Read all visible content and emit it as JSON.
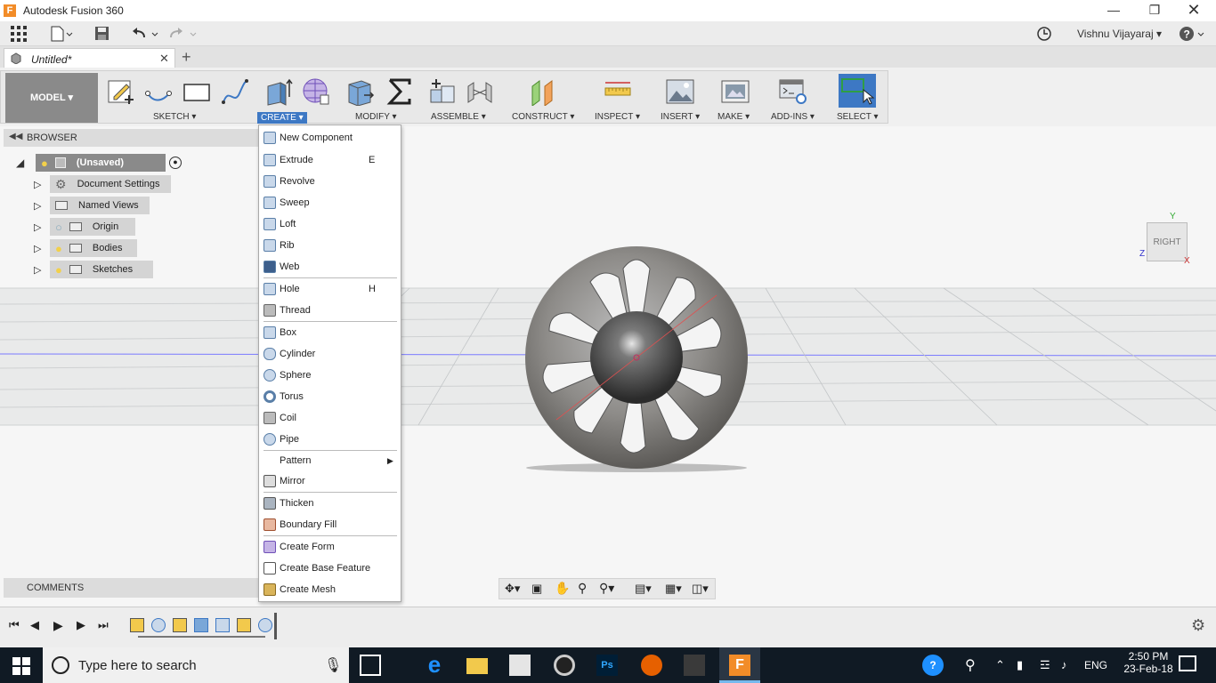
{
  "window": {
    "title": "Autodesk Fusion 360",
    "logo": "F"
  },
  "quick_access": {
    "user": "Vishnu Vijayaraj"
  },
  "tab": {
    "label": "Untitled*"
  },
  "ribbon": {
    "workspace": "MODEL",
    "groups": [
      "SKETCH",
      "CREATE",
      "MODIFY",
      "ASSEMBLE",
      "CONSTRUCT",
      "INSPECT",
      "INSERT",
      "MAKE",
      "ADD-INS",
      "SELECT"
    ]
  },
  "browser": {
    "title": "BROWSER",
    "root": "(Unsaved)",
    "items": [
      "Document Settings",
      "Named Views",
      "Origin",
      "Bodies",
      "Sketches"
    ]
  },
  "comments": {
    "title": "COMMENTS"
  },
  "create_menu": {
    "items": [
      {
        "label": "New Component",
        "shortcut": ""
      },
      {
        "label": "Extrude",
        "shortcut": "E"
      },
      {
        "label": "Revolve",
        "shortcut": ""
      },
      {
        "label": "Sweep",
        "shortcut": ""
      },
      {
        "label": "Loft",
        "shortcut": ""
      },
      {
        "label": "Rib",
        "shortcut": ""
      },
      {
        "label": "Web",
        "shortcut": ""
      },
      {
        "label": "Hole",
        "shortcut": "H"
      },
      {
        "label": "Thread",
        "shortcut": ""
      },
      {
        "label": "Box",
        "shortcut": ""
      },
      {
        "label": "Cylinder",
        "shortcut": ""
      },
      {
        "label": "Sphere",
        "shortcut": ""
      },
      {
        "label": "Torus",
        "shortcut": ""
      },
      {
        "label": "Coil",
        "shortcut": ""
      },
      {
        "label": "Pipe",
        "shortcut": ""
      },
      {
        "label": "Pattern",
        "shortcut": ""
      },
      {
        "label": "Mirror",
        "shortcut": ""
      },
      {
        "label": "Thicken",
        "shortcut": ""
      },
      {
        "label": "Boundary Fill",
        "shortcut": ""
      },
      {
        "label": "Create Form",
        "shortcut": ""
      },
      {
        "label": "Create Base Feature",
        "shortcut": ""
      },
      {
        "label": "Create Mesh",
        "shortcut": ""
      }
    ]
  },
  "viewcube": {
    "face": "RIGHT",
    "axis_y": "Y",
    "axis_x": "X",
    "axis_z": "Z"
  },
  "taskbar": {
    "search_placeholder": "Type here to search",
    "lang": "ENG",
    "time": "2:50 PM",
    "date": "23-Feb-18"
  },
  "colors": {
    "accent": "#3d78c4",
    "taskbar": "#101a24",
    "fusion_orange": "#f28c28"
  }
}
